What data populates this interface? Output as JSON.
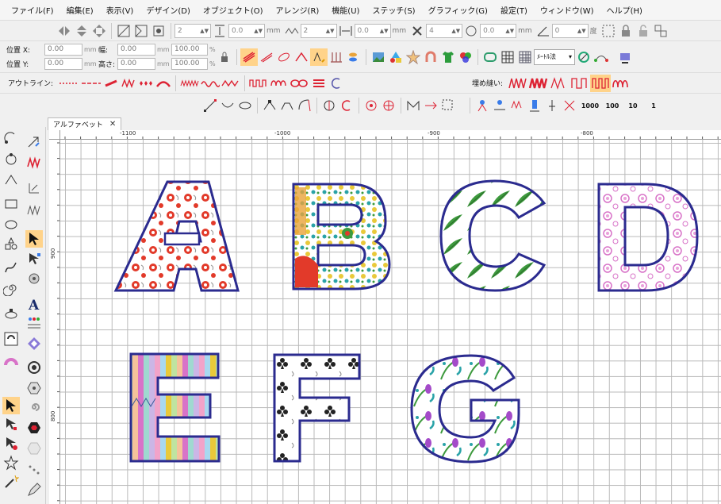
{
  "menu": {
    "items": [
      "ファイル(F)",
      "編集(E)",
      "表示(V)",
      "デザイン(D)",
      "オブジェクト(O)",
      "アレンジ(R)",
      "機能(U)",
      "ステッチ(S)",
      "グラフィック(G)",
      "設定(T)",
      "ウィンドウ(W)",
      "ヘルプ(H)"
    ]
  },
  "toolbar1": {
    "spin1": "2",
    "spin2": "0.0",
    "unit_mm": "mm",
    "spin3": "2",
    "spin4": "0.0",
    "spin5": "4",
    "spin6": "0.0",
    "spin7": "0",
    "unit_deg": "度"
  },
  "position": {
    "x_label": "位置 X:",
    "y_label": "位置 Y:",
    "x_value": "0.00",
    "y_value": "0.00",
    "w_label": "幅:",
    "h_label": "高さ:",
    "w_value": "0.00",
    "h_value": "0.00",
    "wp_value": "100.00",
    "hp_value": "100.00",
    "unit": "mm",
    "pct": "%"
  },
  "measure_combo": "ﾒｰﾄﾙ法",
  "outline_label": "アウトライン:",
  "fill_label": "埋め縫い:",
  "counts": [
    "1000",
    "100",
    "10",
    "1"
  ],
  "tab": {
    "label": "アルファベット",
    "close": "✕"
  },
  "ruler": {
    "top_labels": [
      "-1100",
      "-1000",
      "-900",
      "-800"
    ],
    "left_labels": [
      "900",
      "800"
    ]
  },
  "letters": [
    "A",
    "B",
    "C",
    "D",
    "E",
    "F",
    "G"
  ],
  "colors": {
    "outline": "#2b2b8f",
    "red": "#e23a2a",
    "green": "#3d9a3d",
    "pink": "#d873c8",
    "teal": "#2aa3a8"
  }
}
